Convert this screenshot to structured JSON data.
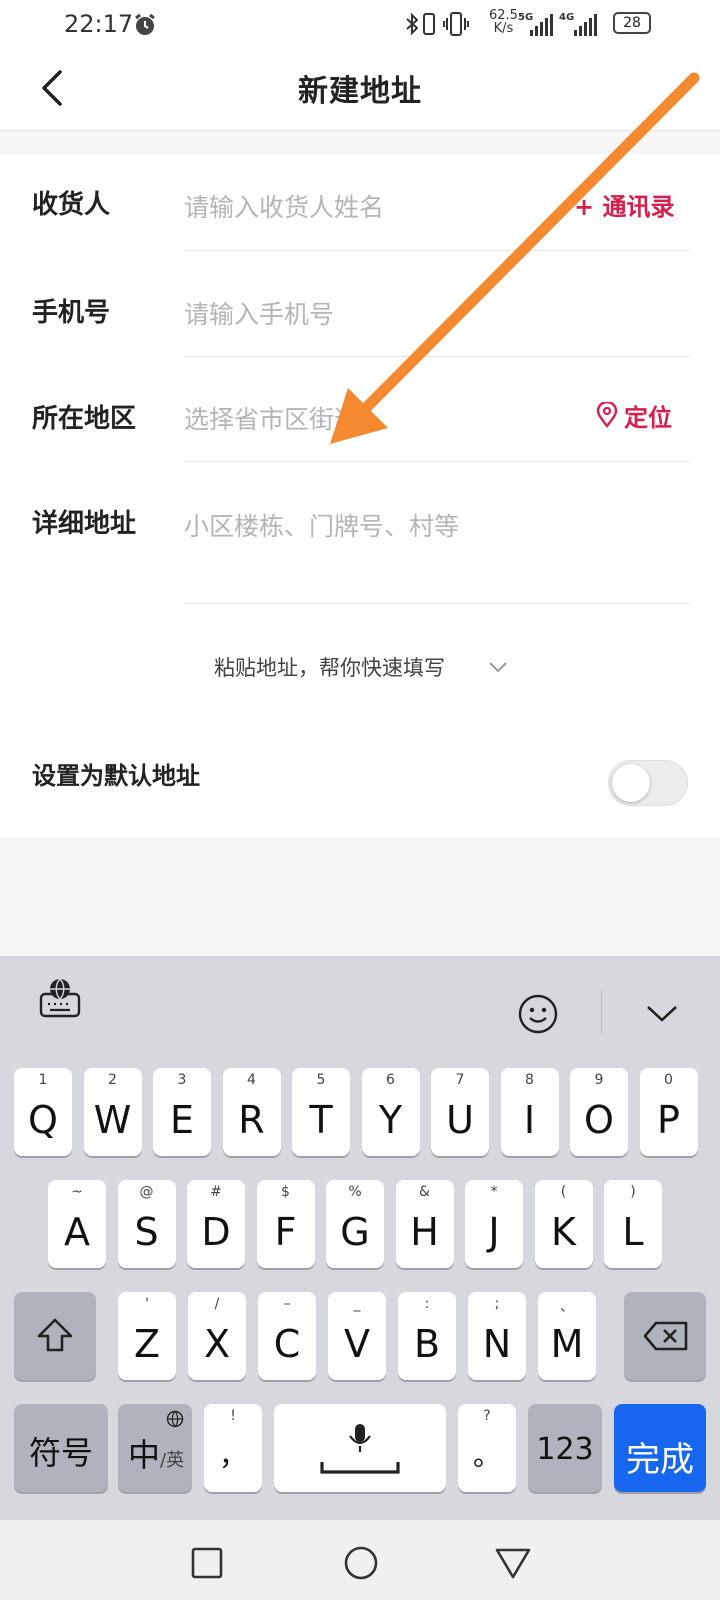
{
  "status_bar": {
    "time": "22:17",
    "speed_value": "62.5",
    "speed_unit": "K/s",
    "network_1": "5G",
    "network_2": "4G",
    "battery": "28"
  },
  "header": {
    "title": "新建地址"
  },
  "form": {
    "receiver": {
      "label": "收货人",
      "placeholder": "请输入收货人姓名",
      "action": "+ 通讯录"
    },
    "phone": {
      "label": "手机号",
      "placeholder": "请输入手机号"
    },
    "region": {
      "label": "所在地区",
      "placeholder": "选择省市区街道",
      "action": "定位"
    },
    "detail": {
      "label": "详细地址",
      "placeholder": "小区楼栋、门牌号、村等"
    },
    "paste_hint": "粘贴地址，帮你快速填写",
    "default_label": "设置为默认地址",
    "default_on": false
  },
  "keyboard": {
    "row1": [
      {
        "k": "Q",
        "s": "1"
      },
      {
        "k": "W",
        "s": "2"
      },
      {
        "k": "E",
        "s": "3"
      },
      {
        "k": "R",
        "s": "4"
      },
      {
        "k": "T",
        "s": "5"
      },
      {
        "k": "Y",
        "s": "6"
      },
      {
        "k": "U",
        "s": "7"
      },
      {
        "k": "I",
        "s": "8"
      },
      {
        "k": "O",
        "s": "9"
      },
      {
        "k": "P",
        "s": "0"
      }
    ],
    "row2": [
      {
        "k": "A",
        "s": "~"
      },
      {
        "k": "S",
        "s": "@"
      },
      {
        "k": "D",
        "s": "#"
      },
      {
        "k": "F",
        "s": "$"
      },
      {
        "k": "G",
        "s": "%"
      },
      {
        "k": "H",
        "s": "&"
      },
      {
        "k": "J",
        "s": "*"
      },
      {
        "k": "K",
        "s": "("
      },
      {
        "k": "L",
        "s": ")"
      }
    ],
    "row3": [
      {
        "k": "Z",
        "s": "'"
      },
      {
        "k": "X",
        "s": "/"
      },
      {
        "k": "C",
        "s": "–"
      },
      {
        "k": "V",
        "s": "_"
      },
      {
        "k": "B",
        "s": ":"
      },
      {
        "k": "N",
        "s": ";"
      },
      {
        "k": "M",
        "s": "、"
      }
    ],
    "symbols": "符号",
    "lang_main": "中",
    "lang_sub": "/英",
    "comma": "，",
    "comma_sub": "!",
    "period": "。",
    "period_sub": "?",
    "num": "123",
    "done": "完成"
  },
  "colors": {
    "accent": "#d81e4d",
    "done_key": "#1766f0",
    "arrow": "#f5892f"
  },
  "icons": [
    "alarm-icon",
    "bluetooth-icon",
    "vibrate-icon",
    "signal-icon",
    "battery-icon",
    "back-icon",
    "location-pin-icon",
    "chevron-down-icon",
    "keyboard-globe-icon",
    "emoji-icon",
    "keyboard-collapse-icon",
    "shift-icon",
    "backspace-icon",
    "globe-icon",
    "mic-icon",
    "square-icon",
    "circle-icon",
    "triangle-icon"
  ]
}
